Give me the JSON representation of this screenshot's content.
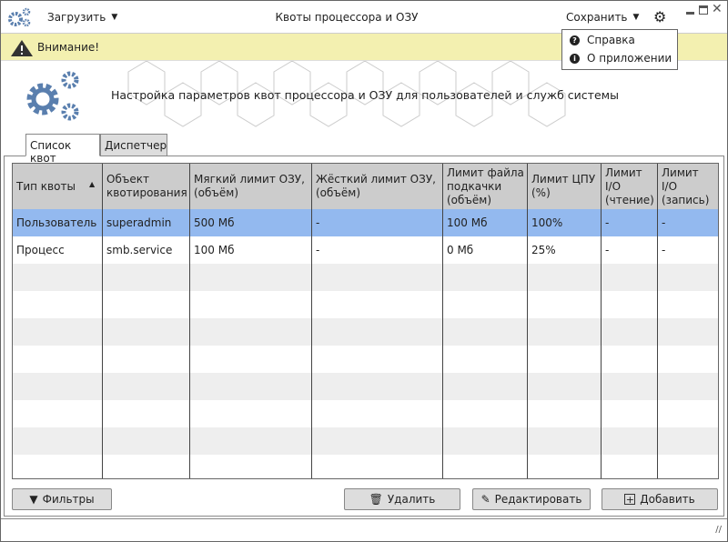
{
  "titlebar": {
    "title": "Квоты процессора и ОЗУ",
    "load_label": "Загрузить",
    "save_label": "Сохранить"
  },
  "menu": {
    "items": [
      {
        "label": "Справка",
        "icon": "question-circle-icon"
      },
      {
        "label": "О приложении",
        "icon": "info-circle-icon"
      }
    ]
  },
  "warning": {
    "label": "Внимание!"
  },
  "header": {
    "text": "Настройка параметров квот процессора и ОЗУ для пользователей и служб системы"
  },
  "tabs": [
    {
      "label": "Список квот",
      "active": true
    },
    {
      "label": "Диспетчер",
      "active": false
    }
  ],
  "table": {
    "columns": [
      "Тип квоты",
      "Объект\nквотирования",
      "Мягкий лимит ОЗУ,\n(объём)",
      "Жёсткий лимит ОЗУ,\n(объём)",
      "Лимит файла\nподкачки\n(объём)",
      "Лимит ЦПУ\n(%)",
      "Лимит\nI/O\n(чтение)",
      "Лимит\nI/O\n(запись)"
    ],
    "sort": {
      "column": "Тип квоты",
      "direction": "ascending"
    },
    "rows": [
      [
        "Пользователь",
        "superadmin",
        "500 Мб",
        "-",
        "100 Мб",
        "100%",
        "-",
        "-"
      ],
      [
        "Процесс",
        "smb.service",
        "100 Мб",
        "-",
        "0 Мб",
        "25%",
        "-",
        "-"
      ]
    ],
    "selected_row": 0
  },
  "buttons": {
    "filters": "Фильтры",
    "delete": "Удалить",
    "edit": "Редактировать",
    "add": "Добавить"
  },
  "colors": {
    "accent": "#5a7fae",
    "selected": "#93b9ef",
    "warning_bg": "#f3f0b0"
  }
}
